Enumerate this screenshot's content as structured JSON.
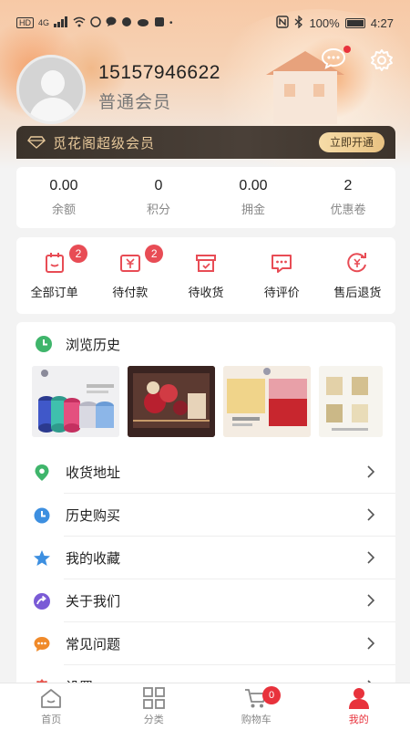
{
  "status_bar": {
    "network_label": "HD",
    "signal_label": "4G",
    "battery": "100%",
    "time": "4:27"
  },
  "profile": {
    "phone": "15157946622",
    "level": "普通会员"
  },
  "vip": {
    "title": "觅花阁超级会员",
    "button": "立即开通"
  },
  "stats": [
    {
      "value": "0.00",
      "label": "余额"
    },
    {
      "value": "0",
      "label": "积分"
    },
    {
      "value": "0.00",
      "label": "拥金"
    },
    {
      "value": "2",
      "label": "优惠卷"
    }
  ],
  "orders": [
    {
      "label": "全部订单",
      "badge": "2",
      "icon": "order-list-icon"
    },
    {
      "label": "待付款",
      "badge": "2",
      "icon": "wallet-icon"
    },
    {
      "label": "待收货",
      "badge": "",
      "icon": "box-icon"
    },
    {
      "label": "待评价",
      "badge": "",
      "icon": "comment-icon"
    },
    {
      "label": "售后退货",
      "badge": "",
      "icon": "refund-icon"
    }
  ],
  "history": {
    "title": "浏览历史",
    "thumbs": [
      "ribbon-rolls",
      "flower-gift-box",
      "soap-flower-box",
      "ribbon-spools"
    ]
  },
  "menu": [
    {
      "label": "收货地址",
      "icon": "location-icon"
    },
    {
      "label": "历史购买",
      "icon": "clock-icon"
    },
    {
      "label": "我的收藏",
      "icon": "star-icon"
    },
    {
      "label": "关于我们",
      "icon": "arrow-circle-icon"
    },
    {
      "label": "常见问题",
      "icon": "chat-dots-icon"
    },
    {
      "label": "设置",
      "icon": "settings-icon"
    }
  ],
  "tabs": [
    {
      "label": "首页",
      "icon": "home-icon"
    },
    {
      "label": "分类",
      "icon": "grid-icon"
    },
    {
      "label": "购物车",
      "icon": "cart-icon",
      "badge": "0"
    },
    {
      "label": "我的",
      "icon": "user-icon"
    }
  ],
  "colors": {
    "accent": "#e8323c",
    "vip_gold": "#e8c99b",
    "icon_red": "#e84c55"
  }
}
